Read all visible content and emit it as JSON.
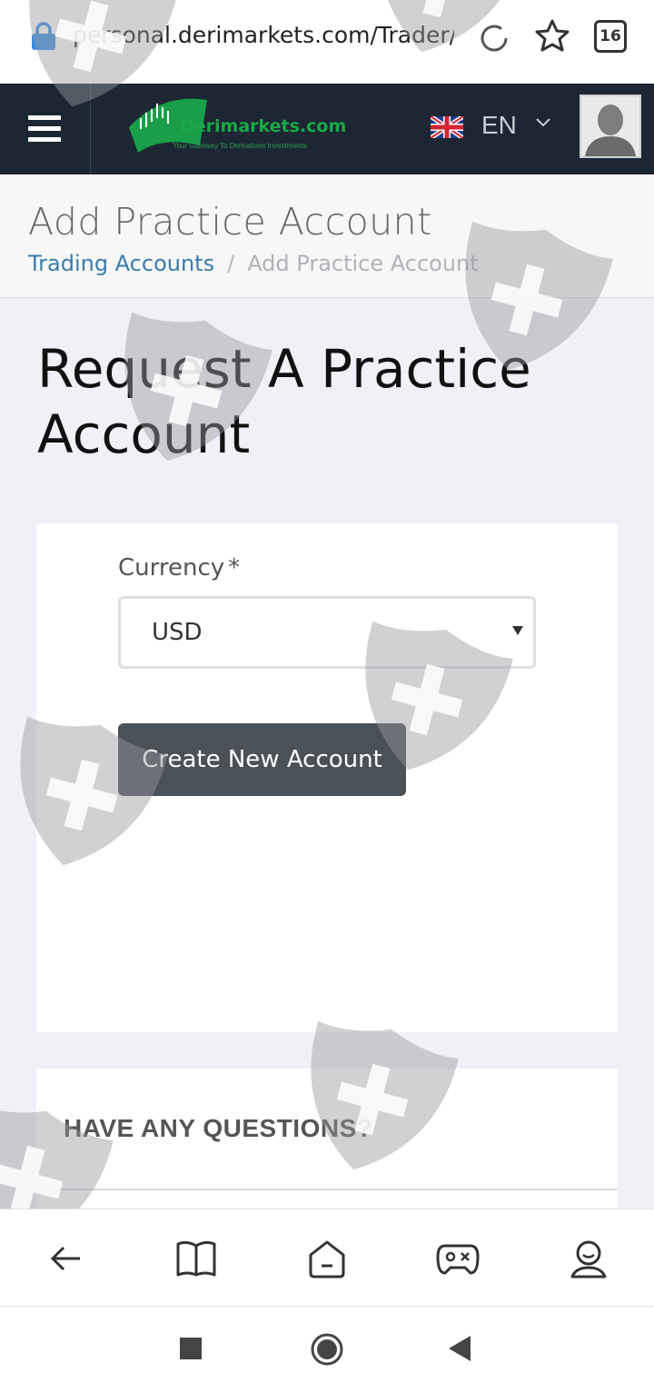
{
  "browser": {
    "url": "personal.derimarkets.com/Trader/",
    "tab_count": "16"
  },
  "header": {
    "logo_name": "Derimarkets.com",
    "logo_tagline": "Your Gateway To Derivatives Investments",
    "language": "EN"
  },
  "titlebar": {
    "title": "Add Practice Account",
    "breadcrumb": [
      {
        "label": "Trading Accounts"
      },
      {
        "separator": "/"
      },
      {
        "label": "Add Practice Account"
      }
    ]
  },
  "main": {
    "heading": "Request A Practice Account",
    "currency_label": "Currency",
    "required_mark": "*",
    "currency_value": "USD",
    "create_button": "Create New Account"
  },
  "faq": {
    "title": "HAVE ANY QUESTIONS?"
  },
  "colors": {
    "header_bg": "#1c2733",
    "link": "#3a7cab",
    "button_bg": "#4a5157",
    "brand_green": "#1aa84a"
  },
  "icons": {
    "browser_nav": [
      "back-arrow-icon",
      "book-icon",
      "home-icon",
      "gamepad-icon",
      "profile-icon"
    ],
    "system_nav": [
      "square-icon",
      "circle-icon",
      "triangle-back-icon"
    ]
  }
}
